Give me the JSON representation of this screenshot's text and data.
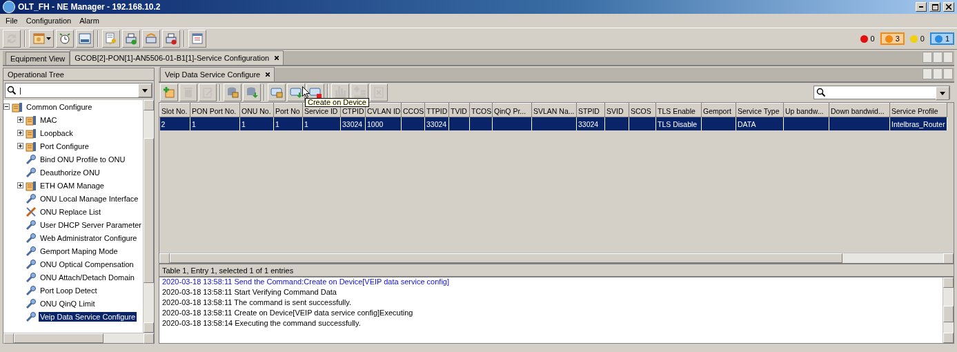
{
  "window": {
    "title": "OLT_FH - NE Manager - 192.168.10.2"
  },
  "menu": [
    "File",
    "Configuration",
    "Alarm"
  ],
  "toolbar": [
    {
      "kind": "refresh",
      "disabled": true
    },
    {
      "kind": "window-menu",
      "disabled": false
    },
    {
      "kind": "clock",
      "disabled": false
    },
    {
      "kind": "device",
      "disabled": false
    },
    {
      "kind": "key-doc",
      "disabled": false
    },
    {
      "kind": "printer-check",
      "disabled": false
    },
    {
      "kind": "printer-sync",
      "disabled": false
    },
    {
      "kind": "printer-stop",
      "disabled": false
    },
    {
      "kind": "panel",
      "disabled": false
    }
  ],
  "alarms": [
    {
      "color": "#e01010",
      "count": "0",
      "selected": false
    },
    {
      "color": "#f08a10",
      "count": "3",
      "selected": true
    },
    {
      "color": "#f0d010",
      "count": "0",
      "selected": false
    },
    {
      "color": "#2a8ae0",
      "count": "1",
      "selected": true
    }
  ],
  "tabs": [
    {
      "label": "Equipment View",
      "selected": false,
      "closable": false
    },
    {
      "label": "GCOB[2]-PON[1]-AN5506-01-B1[1]-Service Configuration",
      "selected": true,
      "closable": true
    }
  ],
  "tree_panel": {
    "title": "Operational Tree",
    "search": {
      "value": "|"
    },
    "items": [
      {
        "label": "Common Configure",
        "kind": "folder",
        "expanded": true,
        "selected": false,
        "children": [
          {
            "label": "MAC",
            "kind": "folder",
            "expanded": false,
            "selected": false
          },
          {
            "label": "Loopback",
            "kind": "folder",
            "expanded": false,
            "selected": false
          },
          {
            "label": "Port Configure",
            "kind": "folder",
            "expanded": false,
            "selected": false
          },
          {
            "label": "Bind ONU Profile to ONU",
            "kind": "tool",
            "selected": false
          },
          {
            "label": "Deauthorize ONU",
            "kind": "tool",
            "selected": false
          },
          {
            "label": "ETH OAM Manage",
            "kind": "folder",
            "expanded": false,
            "selected": false
          },
          {
            "label": "ONU Local Manage Interface",
            "kind": "tool",
            "selected": false
          },
          {
            "label": "ONU Replace List",
            "kind": "repair",
            "selected": false
          },
          {
            "label": "User DHCP Server Parameter",
            "kind": "tool",
            "selected": false
          },
          {
            "label": "Web Administrator Configure",
            "kind": "tool",
            "selected": false
          },
          {
            "label": "Gemport Maping Mode",
            "kind": "tool",
            "selected": false
          },
          {
            "label": "ONU Optical Compensation",
            "kind": "tool",
            "selected": false
          },
          {
            "label": "ONU Attach/Detach Domain",
            "kind": "tool",
            "selected": false
          },
          {
            "label": "Port Loop Detect",
            "kind": "tool",
            "selected": false
          },
          {
            "label": "ONU QinQ Limit",
            "kind": "tool",
            "selected": false
          },
          {
            "label": "Veip Data Service Configure",
            "kind": "tool",
            "selected": true
          }
        ]
      }
    ]
  },
  "content": {
    "tabs": [
      {
        "label": "Veip Data Service Configure",
        "selected": true
      }
    ],
    "toolbar": [
      {
        "kind": "add",
        "disabled": false
      },
      {
        "kind": "delete",
        "disabled": true
      },
      {
        "kind": "edit",
        "disabled": true
      },
      {
        "kind": "db-read",
        "disabled": false
      },
      {
        "kind": "db-save",
        "disabled": false
      },
      {
        "kind": "dev-read",
        "disabled": false
      },
      {
        "kind": "dev-create",
        "disabled": false
      },
      {
        "kind": "dev-delete",
        "disabled": false
      },
      {
        "kind": "hand",
        "disabled": true
      },
      {
        "kind": "add-row",
        "disabled": true
      },
      {
        "kind": "export",
        "disabled": true
      }
    ],
    "tooltip": "Create on Device",
    "table": {
      "columns": [
        "Slot No.",
        "PON Port No.",
        "ONU No.",
        "Port No",
        "Service ID",
        "CTPID",
        "CVLAN ID",
        "CCOS",
        "TTPID",
        "TVID",
        "TCOS",
        "QinQ Pr...",
        "SVLAN Na...",
        "STPID",
        "SVID",
        "SCOS",
        "TLS Enable",
        "Gemport",
        "Service Type",
        "Up bandw...",
        "Down bandwid...",
        "Service Profile"
      ],
      "rows": [
        {
          "selected": true,
          "cells": [
            "2",
            "1",
            "1",
            "1",
            "1",
            "33024",
            "1000",
            "",
            "33024",
            "",
            "",
            "",
            "",
            "33024",
            "",
            "",
            "TLS Disable",
            "",
            "DATA",
            "",
            "",
            "Intelbras_Router"
          ]
        }
      ]
    },
    "status": "Table 1, Entry 1, selected 1 of 1 entries",
    "log": [
      {
        "kind": "command",
        "text": "2020-03-18 13:58:11 Send the Command:Create on Device[VEIP data service config]"
      },
      {
        "kind": "info",
        "text": "2020-03-18 13:58:11 Start Verifying Command Data"
      },
      {
        "kind": "info",
        "text": "2020-03-18 13:58:11 The command is sent successfully."
      },
      {
        "kind": "info",
        "text": "2020-03-18 13:58:11 Create on Device[VEIP data service config]Executing"
      },
      {
        "kind": "info",
        "text": "2020-03-18 13:58:14 Executing the command successfully."
      }
    ]
  }
}
